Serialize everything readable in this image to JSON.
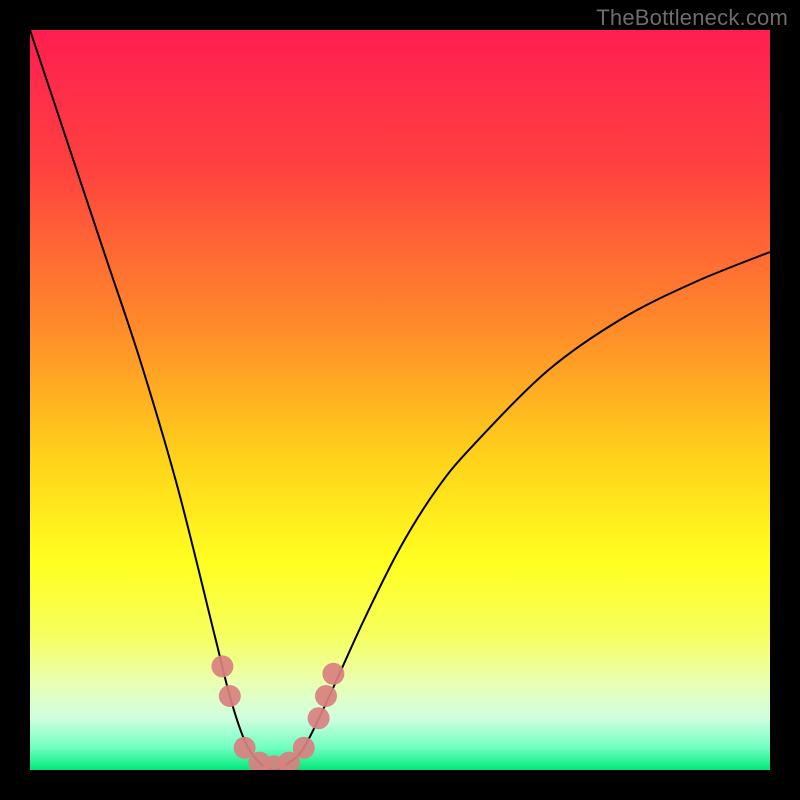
{
  "watermark": "TheBottleneck.com",
  "chart_data": {
    "type": "line",
    "title": "",
    "xlabel": "",
    "ylabel": "",
    "xlim": [
      0,
      100
    ],
    "ylim": [
      0,
      100
    ],
    "grid": false,
    "legend": false,
    "series": [
      {
        "name": "bottleneck-curve",
        "x": [
          0,
          5,
          10,
          15,
          20,
          25,
          27,
          29,
          31,
          33,
          35,
          37,
          40,
          45,
          50,
          55,
          60,
          70,
          80,
          90,
          100
        ],
        "y": [
          100,
          85,
          70,
          55,
          38,
          18,
          10,
          4,
          1,
          0,
          1,
          3,
          9,
          20,
          30,
          38,
          44,
          54,
          61,
          66,
          70
        ]
      }
    ],
    "overlay": {
      "name": "highlight-dots",
      "points": [
        {
          "x": 26,
          "y": 14
        },
        {
          "x": 27,
          "y": 10
        },
        {
          "x": 29,
          "y": 3
        },
        {
          "x": 31,
          "y": 1
        },
        {
          "x": 33,
          "y": 0.5
        },
        {
          "x": 35,
          "y": 1
        },
        {
          "x": 37,
          "y": 3
        },
        {
          "x": 39,
          "y": 7
        },
        {
          "x": 40,
          "y": 10
        },
        {
          "x": 41,
          "y": 13
        }
      ]
    },
    "gradient_stops": [
      {
        "pos": 0.0,
        "color": "#ff1e51"
      },
      {
        "pos": 0.18,
        "color": "#ff4040"
      },
      {
        "pos": 0.4,
        "color": "#ff8a2a"
      },
      {
        "pos": 0.58,
        "color": "#ffd31a"
      },
      {
        "pos": 0.72,
        "color": "#ffff20"
      },
      {
        "pos": 0.82,
        "color": "#f7ff60"
      },
      {
        "pos": 0.88,
        "color": "#eaffb0"
      },
      {
        "pos": 0.93,
        "color": "#d0ffe0"
      },
      {
        "pos": 0.97,
        "color": "#70ffc0"
      },
      {
        "pos": 1.0,
        "color": "#00e87a"
      }
    ]
  }
}
